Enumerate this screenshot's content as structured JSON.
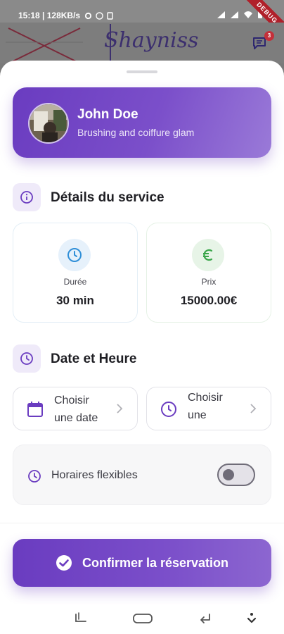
{
  "status_bar": {
    "time": "15:18",
    "speed": "128KB/s",
    "debug_label": "DEBUG"
  },
  "app_bar": {
    "brand": "Shayniss",
    "notification_count": "3",
    "icons": [
      "logo-x-icon",
      "chat-icon"
    ]
  },
  "provider": {
    "name": "John Doe",
    "service": "Brushing and coiffure glam"
  },
  "service_details": {
    "title": "Détails du service",
    "duration": {
      "label": "Durée",
      "value": "30 min",
      "icon": "clock-icon",
      "color": "#2f8fd8"
    },
    "price": {
      "label": "Prix",
      "value": "15000.00€",
      "icon": "euro-icon",
      "color": "#3aa64a"
    }
  },
  "date_time": {
    "title": "Date et Heure",
    "date_picker": {
      "line1": "Choisir",
      "line2": "une date",
      "icon": "calendar-icon"
    },
    "time_picker": {
      "line1": "Choisir",
      "line2": "une",
      "icon": "clock-icon"
    },
    "flexible_label": "Horaires flexibles",
    "flexible_enabled": false
  },
  "confirm_label": "Confirmer la réservation",
  "colors": {
    "accent": "#6a3cc0",
    "accent_light": "#efeaf9"
  }
}
